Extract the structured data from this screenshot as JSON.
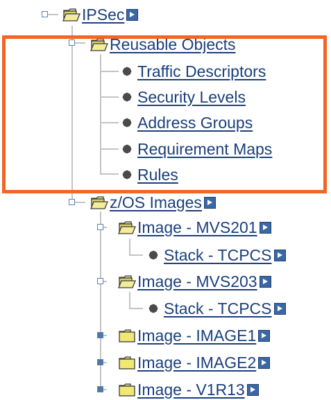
{
  "colors": {
    "link": "#1b3f7c",
    "highlight": "#f26522",
    "tree_line": "#c4c4c4",
    "node_fill": "#4f78a6"
  },
  "tree": {
    "ipsec": {
      "label": "IPSec"
    },
    "reusable_objects": {
      "label": "Reusable Objects",
      "items": [
        {
          "label": "Traffic Descriptors",
          "icon": "bullet-icon"
        },
        {
          "label": "Security Levels",
          "icon": "bullet-icon"
        },
        {
          "label": "Address Groups",
          "icon": "bullet-icon"
        },
        {
          "label": "Requirement Maps",
          "icon": "bullet-icon"
        },
        {
          "label": "Rules",
          "icon": "bullet-icon"
        }
      ]
    },
    "zos_images": {
      "label": "z/OS Images",
      "images": [
        {
          "label": "Image - MVS201",
          "stack": "Stack - TCPCS"
        },
        {
          "label": "Image - MVS203",
          "stack": "Stack - TCPCS"
        },
        {
          "label": "Image - IMAGE1"
        },
        {
          "label": "Image - IMAGE2"
        },
        {
          "label": "Image - V1R13"
        }
      ]
    }
  }
}
